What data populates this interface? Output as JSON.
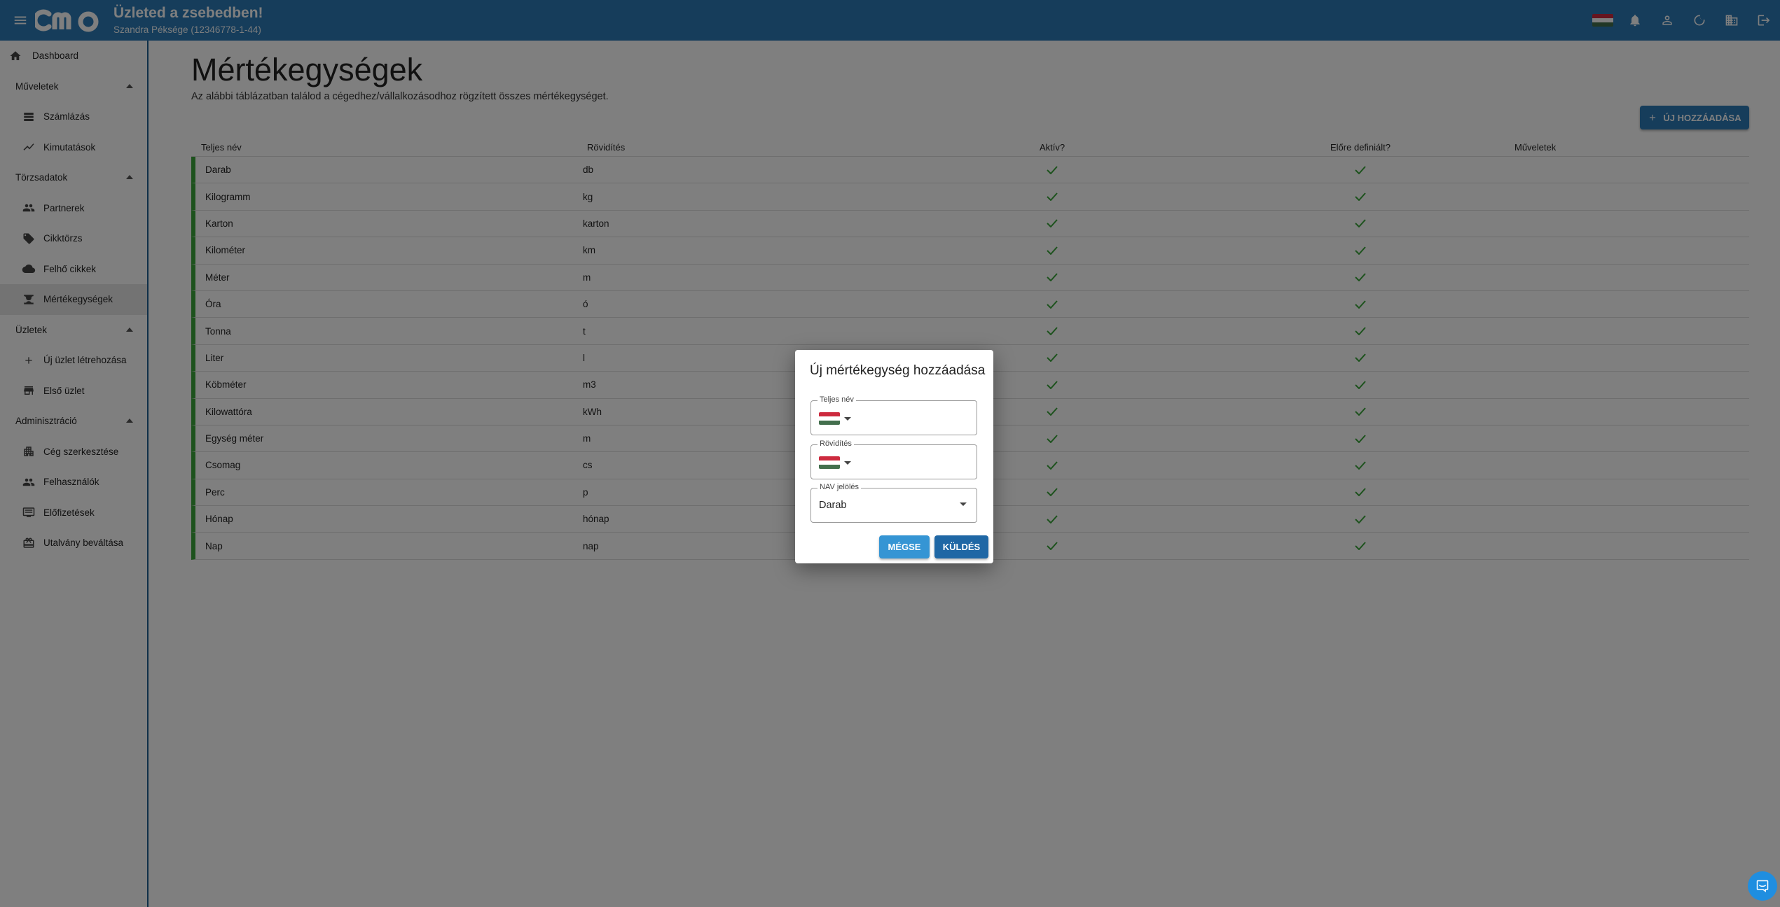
{
  "topbar": {
    "title": "Üzleted a zsebedben!",
    "subtitle": "Szandra Péksége (12346778-1-44)",
    "logo_icon": "cmo-logo",
    "icons": [
      "hungarian-flag-icon",
      "bell-icon",
      "account-icon",
      "dark-mode-icon",
      "company-icon",
      "logout-icon"
    ]
  },
  "sidebar": {
    "dashboard": "Dashboard",
    "sections": [
      {
        "label": "Műveletek",
        "items": [
          {
            "label": "Számlázás",
            "icon": "invoice-icon"
          },
          {
            "label": "Kimutatások",
            "icon": "chart-icon"
          }
        ]
      },
      {
        "label": "Törzsadatok",
        "items": [
          {
            "label": "Partnerek",
            "icon": "people-icon"
          },
          {
            "label": "Cikktörzs",
            "icon": "tag-icon"
          },
          {
            "label": "Felhő cikkek",
            "icon": "cloud-icon"
          },
          {
            "label": "Mértékegységek",
            "icon": "scale-icon"
          }
        ]
      },
      {
        "label": "Üzletek",
        "items": [
          {
            "label": "Új üzlet létrehozása",
            "icon": "plus-icon"
          },
          {
            "label": "Első üzlet",
            "icon": "store-icon"
          }
        ]
      },
      {
        "label": "Adminisztráció",
        "items": [
          {
            "label": "Cég szerkesztése",
            "icon": "domain-icon"
          },
          {
            "label": "Felhasználók",
            "icon": "people-icon"
          },
          {
            "label": "Előfizetések",
            "icon": "monitor-icon"
          },
          {
            "label": "Utalvány beváltása",
            "icon": "voucher-icon"
          }
        ]
      }
    ],
    "active": "Mértékegységek"
  },
  "main": {
    "title": "Mértékegységek",
    "description": "Az alábbi táblázatban találod a cégedhez/vállalkozásodhoz rögzített összes mértékegységet.",
    "add_button": "ÚJ HOZZÁADÁSA",
    "columns": [
      "Teljes név",
      "Rövidítés",
      "Aktív?",
      "Előre definiált?",
      "Műveletek"
    ],
    "rows": [
      {
        "name": "Darab",
        "abbr": "db"
      },
      {
        "name": "Kilogramm",
        "abbr": "kg"
      },
      {
        "name": "Karton",
        "abbr": "karton"
      },
      {
        "name": "Kilométer",
        "abbr": "km"
      },
      {
        "name": "Méter",
        "abbr": "m"
      },
      {
        "name": "Óra",
        "abbr": "ó"
      },
      {
        "name": "Tonna",
        "abbr": "t"
      },
      {
        "name": "Liter",
        "abbr": "l"
      },
      {
        "name": "Köbméter",
        "abbr": "m3"
      },
      {
        "name": "Kilowattóra",
        "abbr": "kWh"
      },
      {
        "name": "Egység méter",
        "abbr": "m"
      },
      {
        "name": "Csomag",
        "abbr": "cs"
      },
      {
        "name": "Perc",
        "abbr": "p"
      },
      {
        "name": "Hónap",
        "abbr": "hónap"
      },
      {
        "name": "Nap",
        "abbr": "nap"
      }
    ]
  },
  "dialog": {
    "title": "Új mértékegység hozzáadása",
    "full_name_label": "Teljes név",
    "full_name_value": "",
    "abbr_label": "Rövidítés",
    "abbr_value": "",
    "nav_label": "NAV jelölés",
    "nav_value": "Darab",
    "cancel": "MÉGSE",
    "send": "KÜLDÉS"
  },
  "colors": {
    "primary": "#2c7ab6",
    "accent": "#3aa53a",
    "check": "#3aa53a"
  }
}
